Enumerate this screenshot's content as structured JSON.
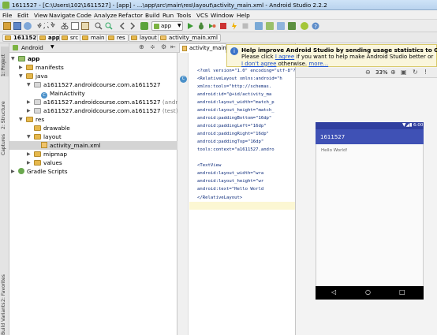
{
  "window": {
    "title": "1611527 - [C:\\Users\\102\\1611527] - [app] - ...\\app\\src\\main\\res\\layout\\activity_main.xml - Android Studio 2.2.2"
  },
  "menu": [
    "File",
    "Edit",
    "View",
    "Navigate",
    "Code",
    "Analyze",
    "Refactor",
    "Build",
    "Run",
    "Tools",
    "VCS",
    "Window",
    "Help"
  ],
  "toolbar": {
    "run_config": "app"
  },
  "breadcrumbs": [
    "1611527",
    "app",
    "src",
    "main",
    "res",
    "layout",
    "activity_main.xml"
  ],
  "left_tabs": [
    "1: Project",
    "2: Structure",
    "Captures",
    "2: Favorites",
    "Build Variants"
  ],
  "project_panel": {
    "view_selector": "Android"
  },
  "tree": [
    {
      "label": "app",
      "bold": true
    },
    {
      "label": "manifests"
    },
    {
      "label": "java"
    },
    {
      "label": "a1611527.androidcourse.com.a1611527"
    },
    {
      "label": "MainActivity"
    },
    {
      "label": "a1611527.androidcourse.com.a1611527",
      "suffix": "(androidTest)"
    },
    {
      "label": "a1611527.androidcourse.com.a1611527",
      "suffix": "(test)"
    },
    {
      "label": "res"
    },
    {
      "label": "drawable"
    },
    {
      "label": "layout"
    },
    {
      "label": "activity_main.xml"
    },
    {
      "label": "mipmap"
    },
    {
      "label": "values"
    },
    {
      "label": "Gradle Scripts"
    }
  ],
  "editor": {
    "tab": "activity_main.xml",
    "code": [
      "<?xml version=\"1.0\" encoding=\"utf-8\"?>",
      "<RelativeLayout xmlns:android=\"h",
      "    xmlns:tools=\"http://schemas.",
      "    android:id=\"@+id/activity_ma",
      "    android:layout_width=\"match_p",
      "    android:layout_height=\"match_",
      "    android:paddingBottom=\"16dp\"",
      "    android:paddingLeft=\"16dp\"",
      "    android:paddingRight=\"16dp\"",
      "    android:paddingTop=\"16dp\"",
      "    tools:context=\"a1611527.andro",
      "",
      "    <TextView",
      "        android:layout_width=\"wra",
      "        android:layout_height=\"wr",
      "        android:text=\"Hello World",
      "</RelativeLayout>"
    ]
  },
  "notification": {
    "title": "Help improve Android Studio by sending usage statistics to Google",
    "line1_pre": "Please click ",
    "agree": "I agree",
    "line1_post": " if you want to help make Android Studio better or ",
    "dont_agree": "I don't agree",
    "line2_post": " otherwise. ",
    "more": "more..."
  },
  "preview": {
    "zoom": "33%",
    "app_title": "1611527",
    "hello": "Hello World!",
    "status_time": "6:00"
  }
}
